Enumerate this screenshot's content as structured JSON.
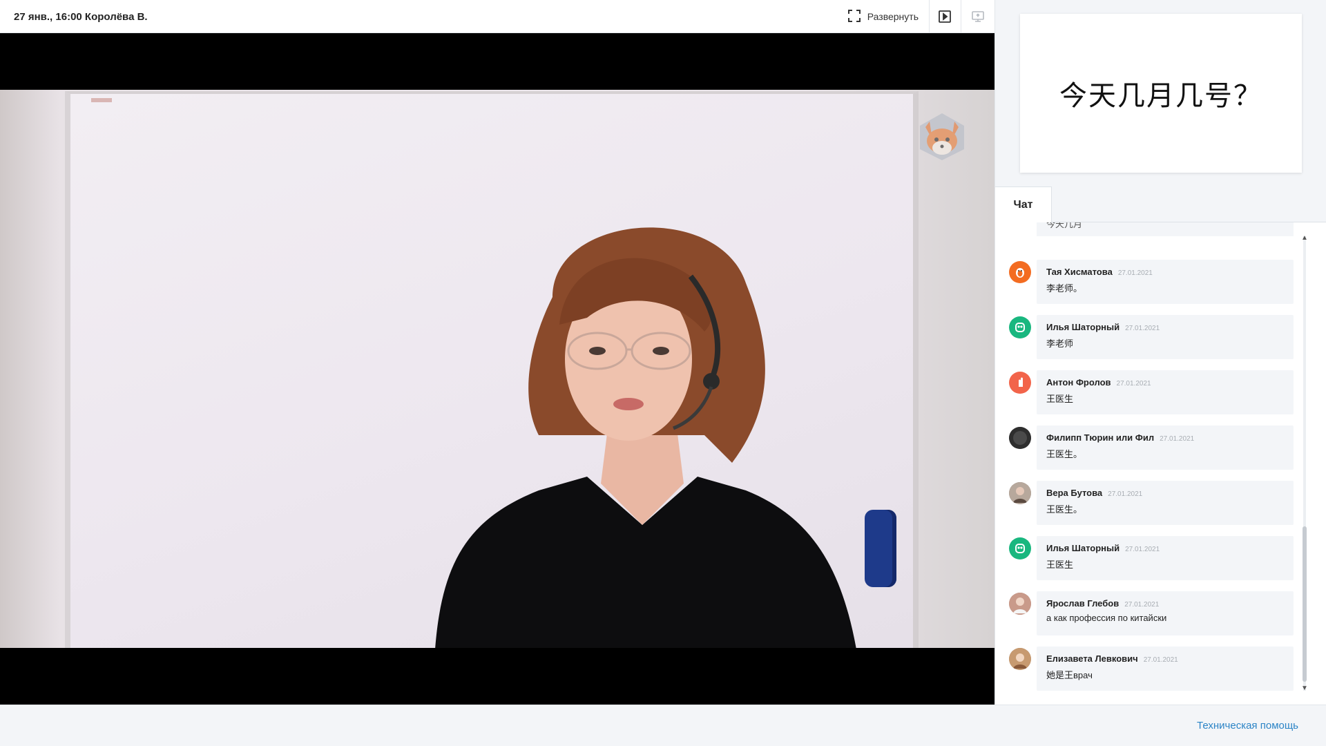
{
  "topbar": {
    "title": "27 янв., 16:00 Королёва В.",
    "expand_label": "Развернуть",
    "icons": [
      "expand-icon",
      "play-square-icon",
      "screen-share-icon"
    ]
  },
  "slide": {
    "text": "今天几月几号？"
  },
  "chat": {
    "tab_label": "Чат",
    "truncated_text": "今天几月",
    "messages": [
      {
        "name": "Тая Хисматова",
        "date": "27.01.2021",
        "text": "李老师。",
        "avatar_icon": "penguin-avatar-icon",
        "avatar_color": "#f36c21"
      },
      {
        "name": "Илья Шаторный",
        "date": "27.01.2021",
        "text": "李老师",
        "avatar_icon": "owl-avatar-icon",
        "avatar_color": "#19b77f"
      },
      {
        "name": "Антон Фролов",
        "date": "27.01.2021",
        "text": "王医生",
        "avatar_icon": "hand-avatar-icon",
        "avatar_color": "#f2644a"
      },
      {
        "name": "Филипп Тюрин или Фил",
        "date": "27.01.2021",
        "text": "王医生。",
        "avatar_icon": "photo-avatar",
        "avatar_color": "#3a3a3a"
      },
      {
        "name": "Вера Бутова",
        "date": "27.01.2021",
        "text": "王医生。",
        "avatar_icon": "photo-avatar",
        "avatar_color": "#8a7a70"
      },
      {
        "name": "Илья Шаторный",
        "date": "27.01.2021",
        "text": "王医生",
        "avatar_icon": "owl-avatar-icon",
        "avatar_color": "#19b77f"
      },
      {
        "name": "Ярослав Глебов",
        "date": "27.01.2021",
        "text": "а как профессия по китайски",
        "avatar_icon": "photo-avatar",
        "avatar_color": "#b07a6a"
      },
      {
        "name": "Елизавета Левкович",
        "date": "27.01.2021",
        "text": "她是王врач",
        "avatar_icon": "photo-avatar",
        "avatar_color": "#a87c5a"
      }
    ]
  },
  "footer": {
    "help_label": "Техническая помощь"
  },
  "colors": {
    "accent": "#2b84c6",
    "background": "#f3f5f8"
  }
}
